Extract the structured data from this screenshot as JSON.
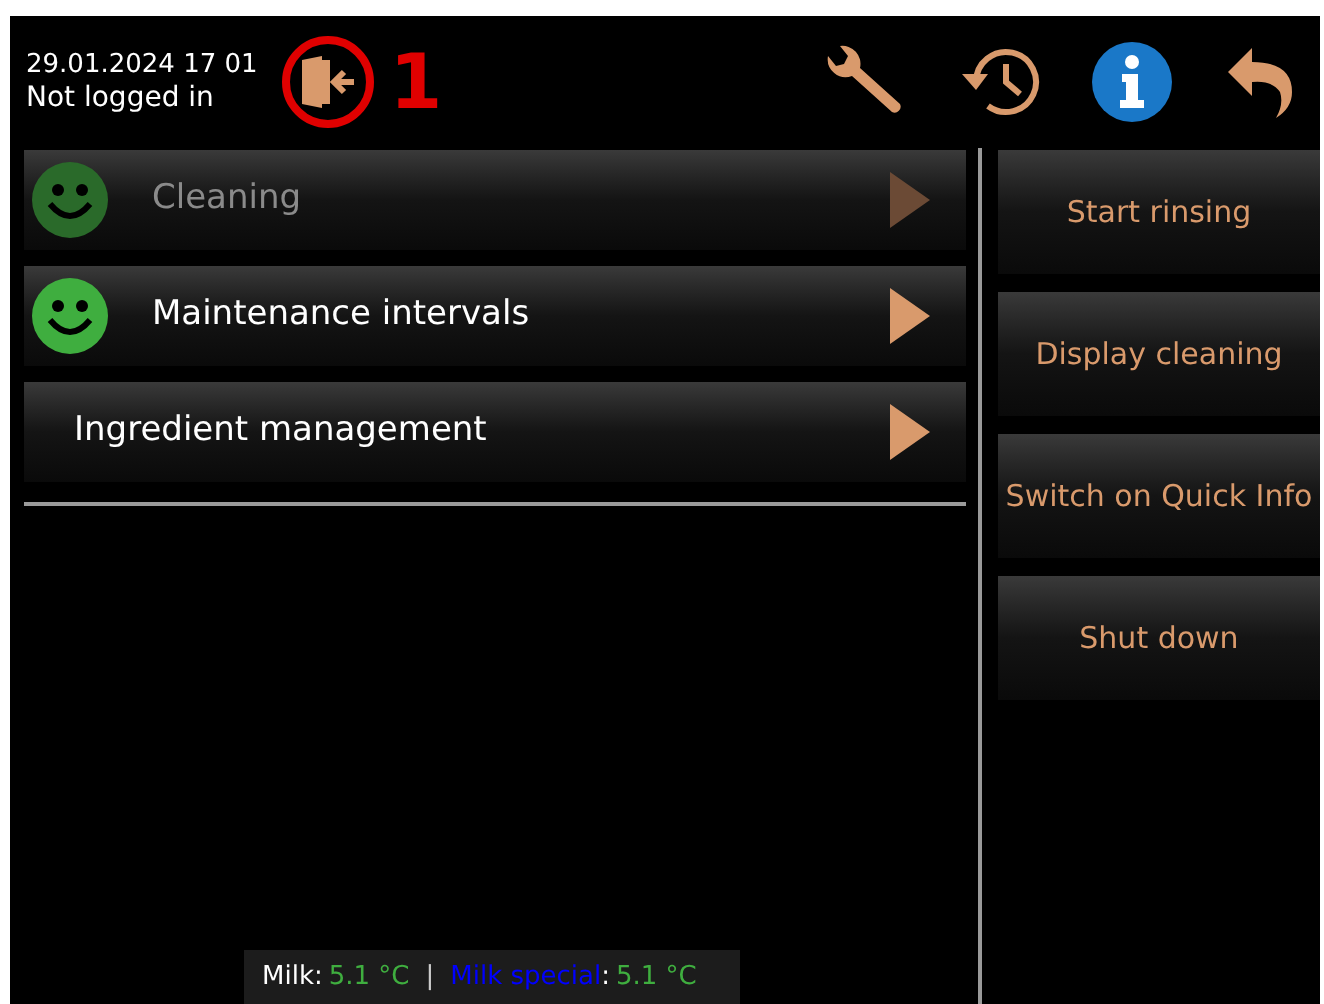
{
  "header": {
    "datetime": "29.01.2024 17 01",
    "login_status": "Not logged in",
    "callout": "1"
  },
  "menu": [
    {
      "label": "Cleaning",
      "smiley": true,
      "disabled": true
    },
    {
      "label": "Maintenance intervals",
      "smiley": true,
      "disabled": false
    },
    {
      "label": "Ingredient management",
      "smiley": false,
      "disabled": false
    }
  ],
  "actions": [
    "Start rinsing",
    "Display cleaning",
    "Switch on Quick Info",
    "Shut down"
  ],
  "status_bar": [
    {
      "label": "Milk",
      "color": "#ffffff",
      "value": "5.1 °C"
    },
    {
      "label": "Milk special",
      "color": "#0000ff",
      "value": "5.1 °C"
    }
  ],
  "separator": "|",
  "colon": ":"
}
